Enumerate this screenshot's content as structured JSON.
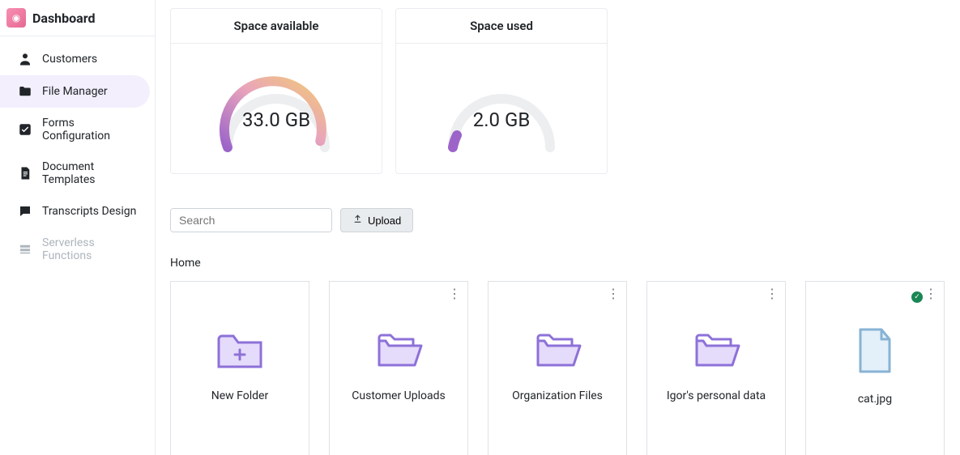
{
  "brand": {
    "title": "Dashboard"
  },
  "sidebar": {
    "items": [
      {
        "label": "Customers",
        "icon": "person-icon",
        "active": false,
        "disabled": false
      },
      {
        "label": "File Manager",
        "icon": "folder-icon",
        "active": true,
        "disabled": false
      },
      {
        "label": "Forms Configuration",
        "icon": "checkbox-icon",
        "active": false,
        "disabled": false
      },
      {
        "label": "Document Templates",
        "icon": "document-icon",
        "active": false,
        "disabled": false
      },
      {
        "label": "Transcripts Design",
        "icon": "chat-icon",
        "active": false,
        "disabled": false
      },
      {
        "label": "Serverless Functions",
        "icon": "layers-icon",
        "active": false,
        "disabled": true
      }
    ]
  },
  "gauges": {
    "available": {
      "title": "Space available",
      "value": "33.0 GB",
      "fraction": 0.94
    },
    "used": {
      "title": "Space used",
      "value": "2.0 GB",
      "fraction": 0.06
    }
  },
  "search": {
    "placeholder": "Search"
  },
  "upload": {
    "label": "Upload"
  },
  "breadcrumb": {
    "path": "Home"
  },
  "cards": [
    {
      "label": "New Folder",
      "type": "new-folder",
      "menu": false,
      "checked": false
    },
    {
      "label": "Customer Uploads",
      "type": "folder",
      "menu": true,
      "checked": false
    },
    {
      "label": "Organization Files",
      "type": "folder",
      "menu": true,
      "checked": false
    },
    {
      "label": "Igor's personal data",
      "type": "folder",
      "menu": true,
      "checked": false
    },
    {
      "label": "cat.jpg",
      "type": "file",
      "menu": true,
      "checked": true
    }
  ],
  "colors": {
    "accentPurple": "#9c88ff",
    "gaugeGradientStart": "#9c88ff",
    "gaugeGradientEnd": "#f1c977",
    "folderFill": "#e5dbfa",
    "folderStroke": "#8d71d8",
    "fileFill": "#e3f0f9",
    "fileStroke": "#88b3d4"
  }
}
